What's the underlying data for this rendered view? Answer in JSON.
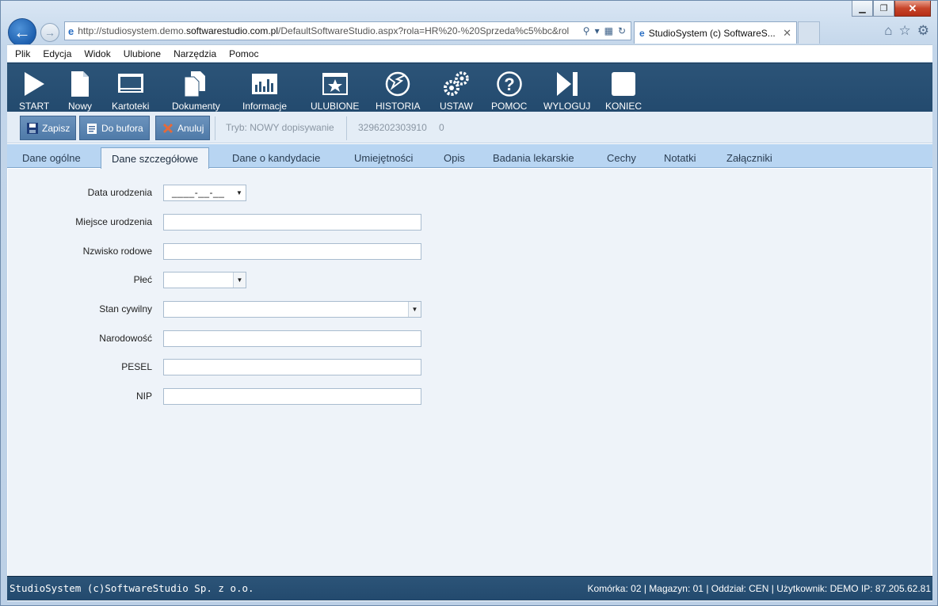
{
  "browser": {
    "url_prefix": "http://studiosystem.demo.",
    "url_domain": "softwarestudio.com.pl",
    "url_suffix": "/DefaultSoftwareStudio.aspx?rola=HR%20-%20Sprzeda%c5%bc&rol",
    "tab_title": "StudioSystem (c) SoftwareS...",
    "tab_close": "✕"
  },
  "menu": [
    "Plik",
    "Edycja",
    "Widok",
    "Ulubione",
    "Narzędzia",
    "Pomoc"
  ],
  "toolbar": {
    "items": [
      "START",
      "Nowy",
      "Kartoteki",
      "Dokumenty",
      "Informacje",
      "ULUBIONE",
      "HISTORIA",
      "USTAW",
      "POMOC",
      "WYLOGUJ",
      "KONIEC"
    ]
  },
  "actions": {
    "save": "Zapisz",
    "buffer": "Do bufora",
    "cancel": "Anuluj",
    "mode": "Tryb: NOWY dopisywanie",
    "record_id": "3296202303910",
    "record_num": "0"
  },
  "tabs": [
    "Dane ogólne",
    "Dane szczegółowe",
    "Dane o kandydacie",
    "Umiejętności",
    "Opis",
    "Badania lekarskie",
    "Cechy",
    "Notatki",
    "Załączniki"
  ],
  "active_tab": "Dane szczegółowe",
  "form": {
    "birth_date_label": "Data urodzenia",
    "birth_date_value": "____-__-__",
    "birth_place_label": "Miejsce urodzenia",
    "birth_place_value": "",
    "maiden_name_label": "Nzwisko rodowe",
    "maiden_name_value": "",
    "sex_label": "Płeć",
    "sex_value": "",
    "marital_label": "Stan cywilny",
    "marital_value": "",
    "nationality_label": "Narodowość",
    "nationality_value": "",
    "pesel_label": "PESEL",
    "pesel_value": "",
    "nip_label": "NIP",
    "nip_value": ""
  },
  "status": {
    "left": "StudioSystem (c)SoftwareStudio Sp. z o.o.",
    "right": "Komórka: 02 | Magazyn: 01 | Oddział: CEN | Użytkownik: DEMO IP: 87.205.62.81"
  },
  "colors": {
    "toolbar_bg": "#234a6e",
    "tabs_bg": "#b8d5f2",
    "form_bg": "#eef3f9",
    "action_button": "#5a83b0"
  }
}
